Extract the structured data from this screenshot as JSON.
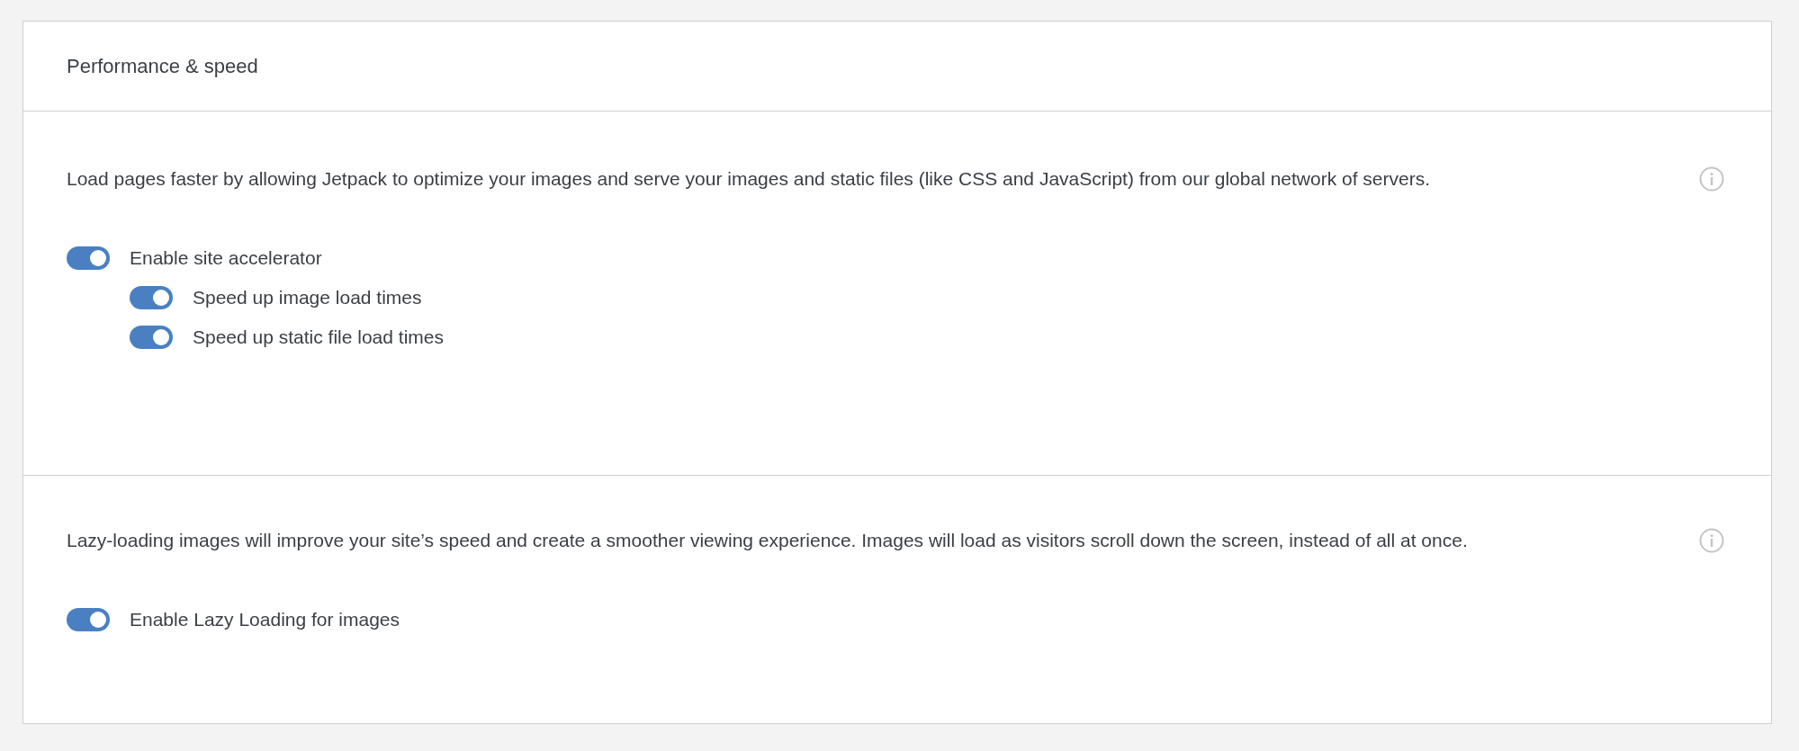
{
  "card": {
    "title": "Performance & speed",
    "sections": [
      {
        "description": "Load pages faster by allowing Jetpack to optimize your images and serve your images and static files (like CSS and JavaScript) from our global network of servers.",
        "toggles": [
          {
            "label": "Enable site accelerator",
            "on": true,
            "children": [
              {
                "label": "Speed up image load times",
                "on": true
              },
              {
                "label": "Speed up static file load times",
                "on": true
              }
            ]
          }
        ]
      },
      {
        "description": "Lazy-loading images will improve your site’s speed and create a smoother viewing experience. Images will load as visitors scroll down the screen, instead of all at once.",
        "toggles": [
          {
            "label": "Enable Lazy Loading for images",
            "on": true
          }
        ]
      }
    ]
  }
}
